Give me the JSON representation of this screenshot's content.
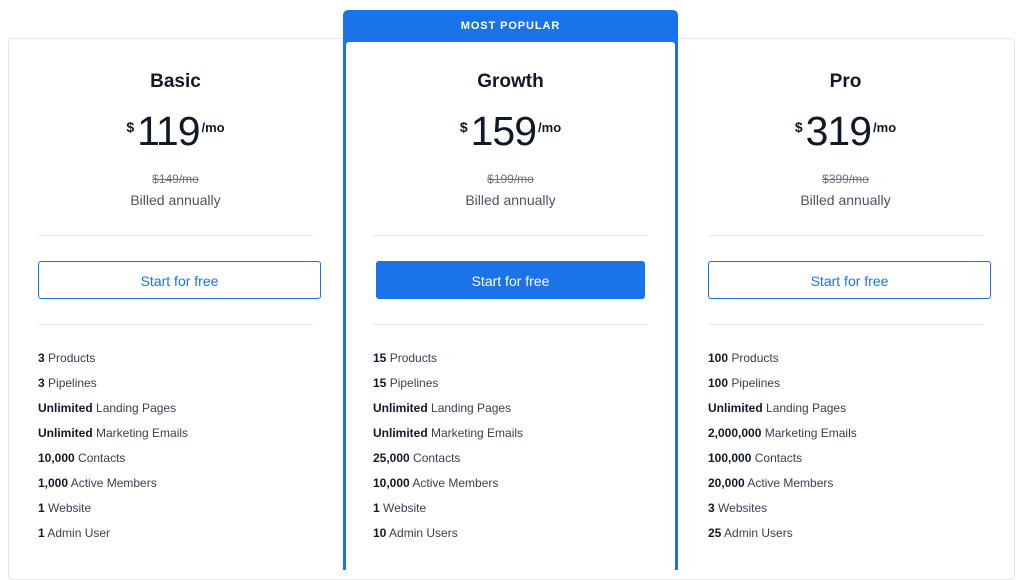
{
  "badge": "MOST POPULAR",
  "plans": [
    {
      "name": "Basic",
      "currency": "$",
      "amount": "119",
      "period": "/mo",
      "old_price": "$149/mo",
      "billing": "Billed annually",
      "cta": "Start for free",
      "features": [
        {
          "bold": "3",
          "text": "Products"
        },
        {
          "bold": "3",
          "text": "Pipelines"
        },
        {
          "bold": "Unlimited",
          "text": "Landing Pages"
        },
        {
          "bold": "Unlimited",
          "text": "Marketing Emails"
        },
        {
          "bold": "10,000",
          "text": "Contacts"
        },
        {
          "bold": "1,000",
          "text": "Active Members"
        },
        {
          "bold": "1",
          "text": "Website"
        },
        {
          "bold": "1",
          "text": "Admin User"
        }
      ]
    },
    {
      "name": "Growth",
      "currency": "$",
      "amount": "159",
      "period": "/mo",
      "old_price": "$199/mo",
      "billing": "Billed annually",
      "cta": "Start for free",
      "features": [
        {
          "bold": "15",
          "text": "Products"
        },
        {
          "bold": "15",
          "text": "Pipelines"
        },
        {
          "bold": "Unlimited",
          "text": "Landing Pages"
        },
        {
          "bold": "Unlimited",
          "text": "Marketing Emails"
        },
        {
          "bold": "25,000",
          "text": "Contacts"
        },
        {
          "bold": "10,000",
          "text": "Active Members"
        },
        {
          "bold": "1",
          "text": "Website"
        },
        {
          "bold": "10",
          "text": "Admin Users"
        }
      ]
    },
    {
      "name": "Pro",
      "currency": "$",
      "amount": "319",
      "period": "/mo",
      "old_price": "$399/mo",
      "billing": "Billed annually",
      "cta": "Start for free",
      "features": [
        {
          "bold": "100",
          "text": "Products"
        },
        {
          "bold": "100",
          "text": "Pipelines"
        },
        {
          "bold": "Unlimited",
          "text": "Landing Pages"
        },
        {
          "bold": "2,000,000",
          "text": "Marketing Emails"
        },
        {
          "bold": "100,000",
          "text": "Contacts"
        },
        {
          "bold": "20,000",
          "text": "Active Members"
        },
        {
          "bold": "3",
          "text": "Websites"
        },
        {
          "bold": "25",
          "text": "Admin Users"
        }
      ]
    }
  ],
  "colors": {
    "accent": "#1a73e8",
    "text": "#111827",
    "muted": "#6b7280",
    "divider": "#e5e7eb"
  }
}
